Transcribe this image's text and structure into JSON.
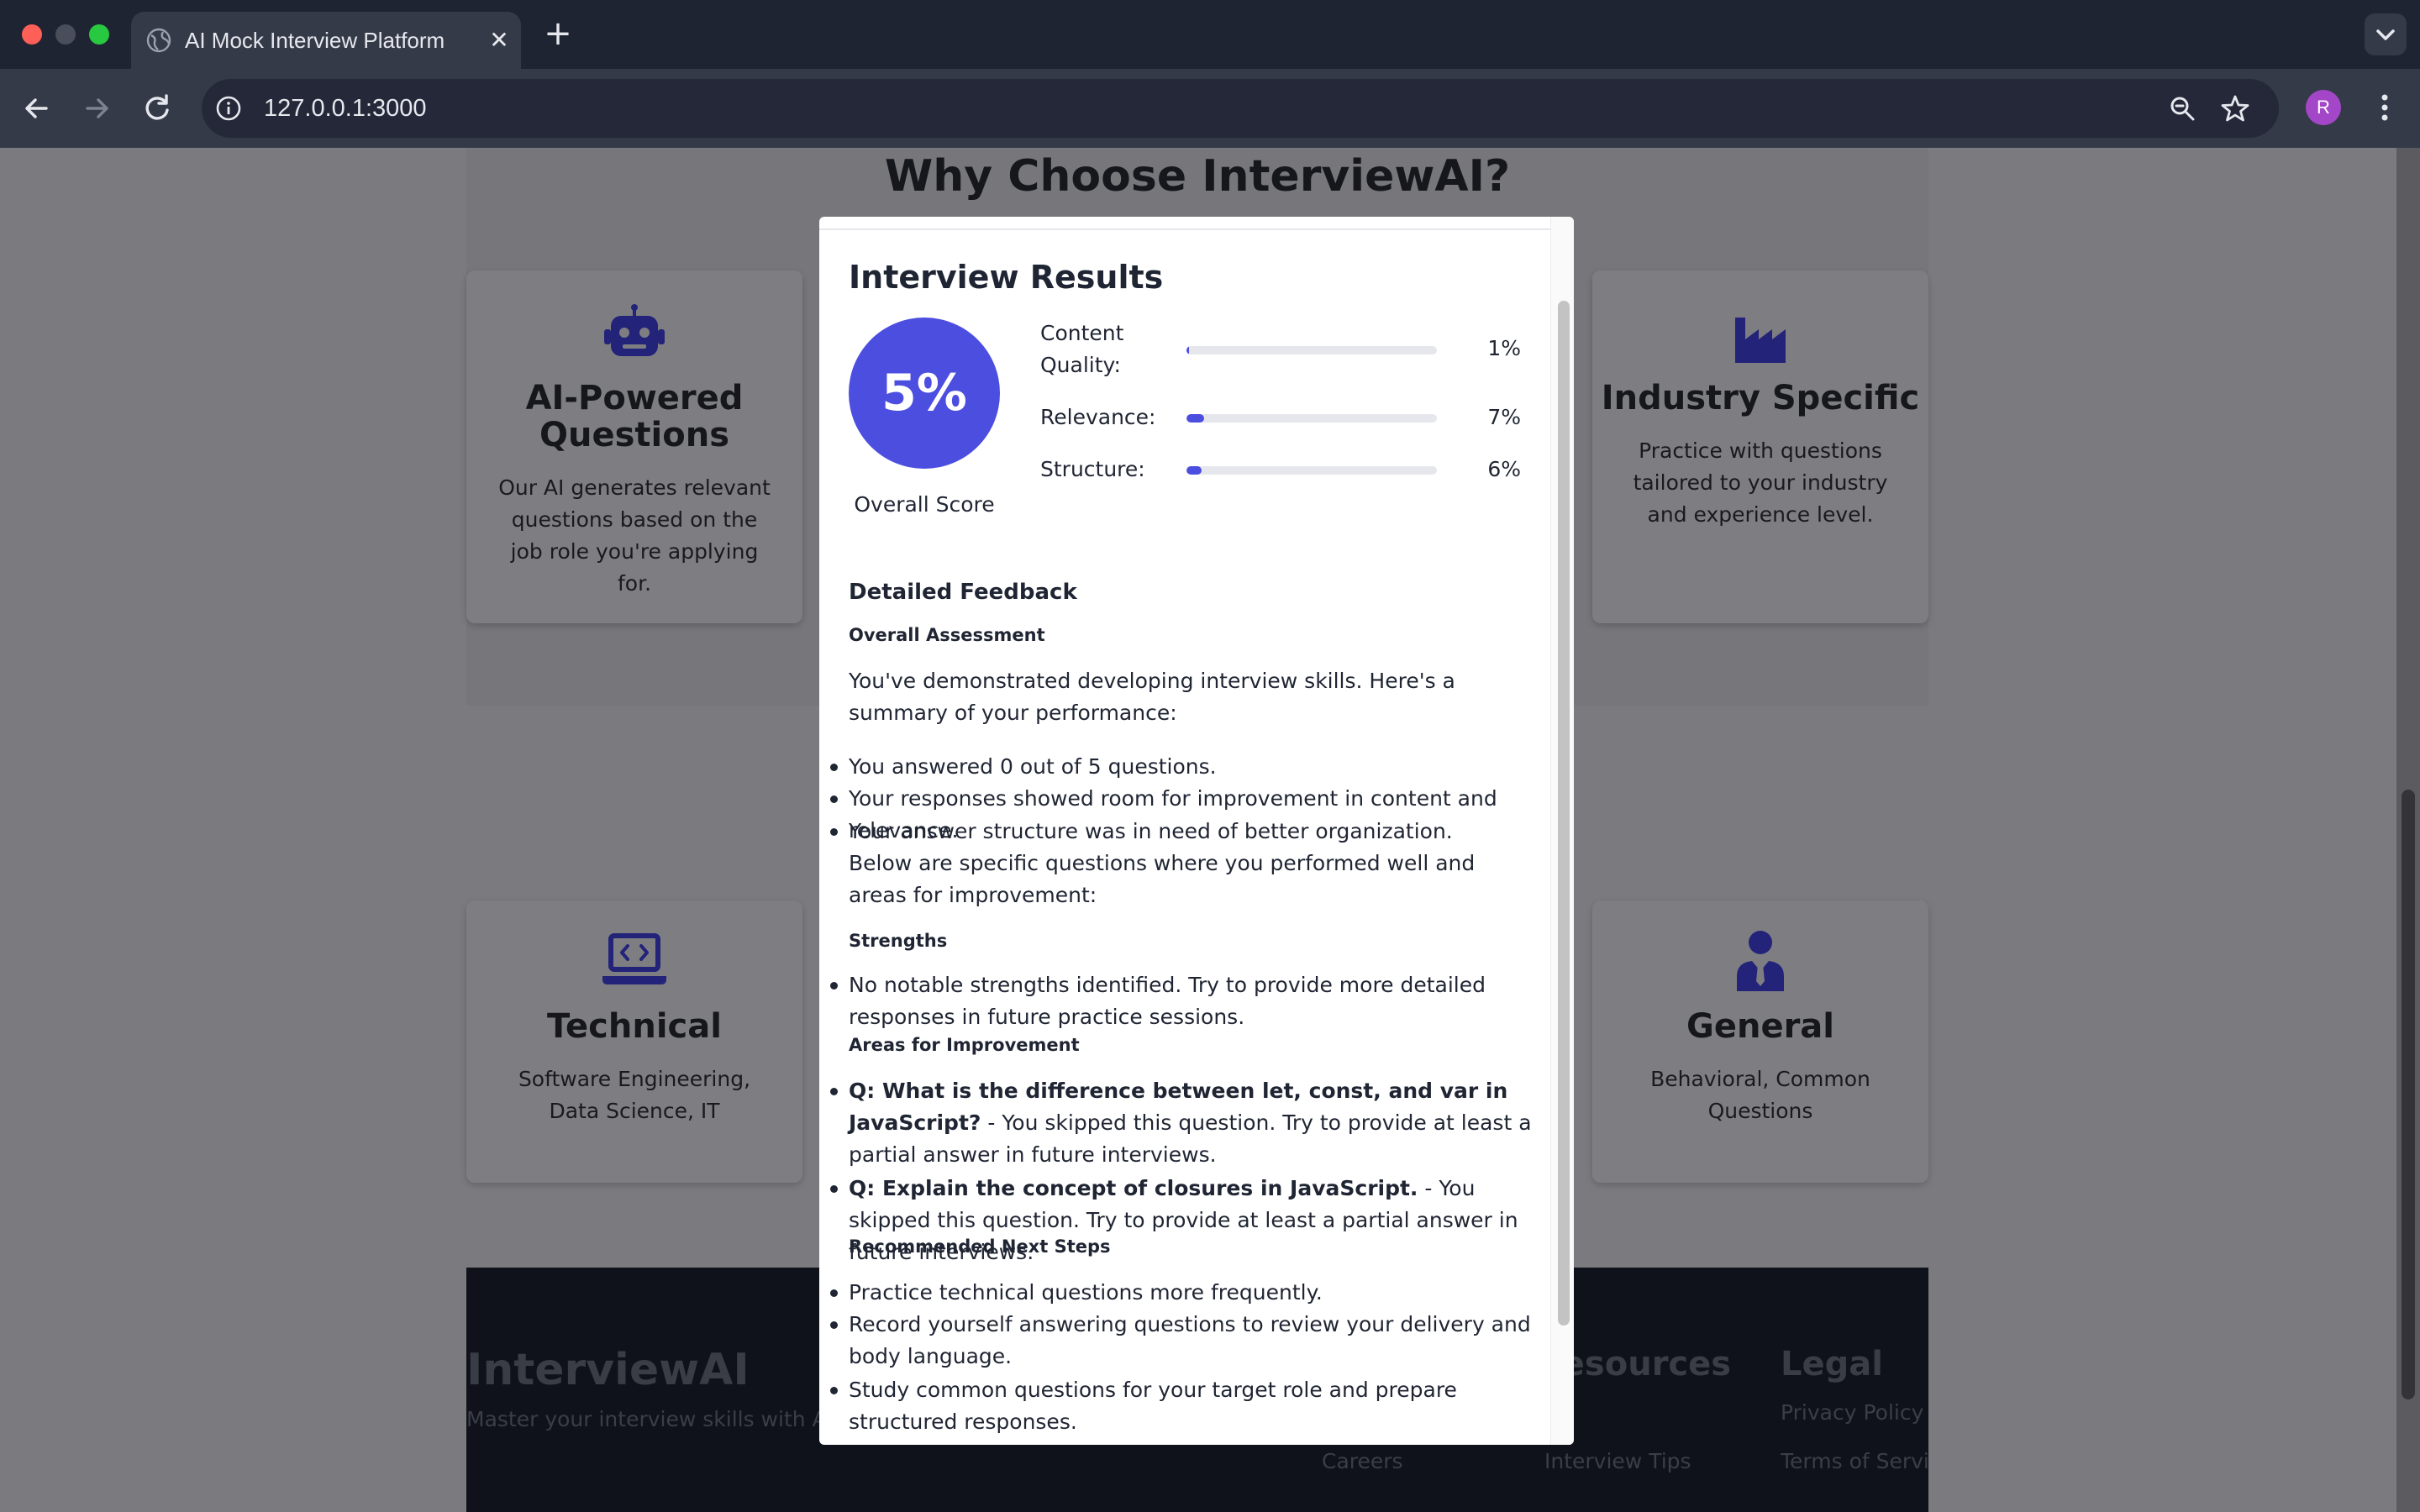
{
  "browser": {
    "tab_title": "AI Mock Interview Platform",
    "url": "127.0.0.1:3000",
    "profile_initial": "R"
  },
  "page": {
    "heading": "Why Choose InterviewAI?",
    "features": [
      {
        "icon": "robot-icon",
        "title": "AI-Powered Questions",
        "text": "Our AI generates relevant questions based on the job role you're applying for."
      },
      {
        "icon": "industry-icon",
        "title": "Industry Specific",
        "text": "Practice with questions tailored to your industry and experience level."
      }
    ],
    "categories": [
      {
        "icon": "laptop-code-icon",
        "title": "Technical",
        "text": "Software Engineering, Data Science, IT"
      },
      {
        "icon": "user-tie-icon",
        "title": "General",
        "text": "Behavioral, Common Questions"
      }
    ],
    "footer": {
      "brand": "InterviewAI",
      "tagline": "Master your interview skills with AI",
      "resources_title": "Resources",
      "legal_title": "Legal",
      "links": {
        "careers": "Careers",
        "interview_tips": "Interview Tips",
        "privacy_policy": "Privacy Policy",
        "terms": "Terms of Service"
      }
    }
  },
  "modal": {
    "title": "Interview Results",
    "overall_score": "5%",
    "overall_score_value": 5,
    "overall_label": "Overall Score",
    "metrics": [
      {
        "label": "Content Quality:",
        "value": "1%",
        "percent": 1
      },
      {
        "label": "Relevance:",
        "value": "7%",
        "percent": 7
      },
      {
        "label": "Structure:",
        "value": "6%",
        "percent": 6
      }
    ],
    "feedback": {
      "heading": "Detailed Feedback",
      "overall_title": "Overall Assessment",
      "overall_intro": "You've demonstrated developing interview skills. Here's a summary of your performance:",
      "summary_items": [
        "You answered 0 out of 5 questions.",
        "Your responses showed room for improvement in content and relevance.",
        "Your answer structure was in need of better organization."
      ],
      "summary_followup": "Below are specific questions where you performed well and areas for improvement:",
      "strengths_title": "Strengths",
      "strengths_items": [
        "No notable strengths identified. Try to provide more detailed responses in future practice sessions."
      ],
      "improvement_title": "Areas for Improvement",
      "improvement_items": [
        {
          "question": "Q: What is the difference between let, const, and var in JavaScript?",
          "comment": " - You skipped this question. Try to provide at least a partial answer in future interviews."
        },
        {
          "question": "Q: Explain the concept of closures in JavaScript.",
          "comment": " - You skipped this question. Try to provide at least a partial answer in future interviews."
        }
      ],
      "next_steps_title": "Recommended Next Steps",
      "next_steps_items": [
        "Practice technical questions more frequently.",
        "Record yourself answering questions to review your delivery and body language.",
        "Study common questions for your target role and prepare structured responses."
      ]
    }
  },
  "colors": {
    "accent": "#4c4ee0",
    "tabbar": "#1f2433",
    "toolbar": "#353a48",
    "page_overlay": "#7b7b7f",
    "icon_dim": "#23237a"
  }
}
